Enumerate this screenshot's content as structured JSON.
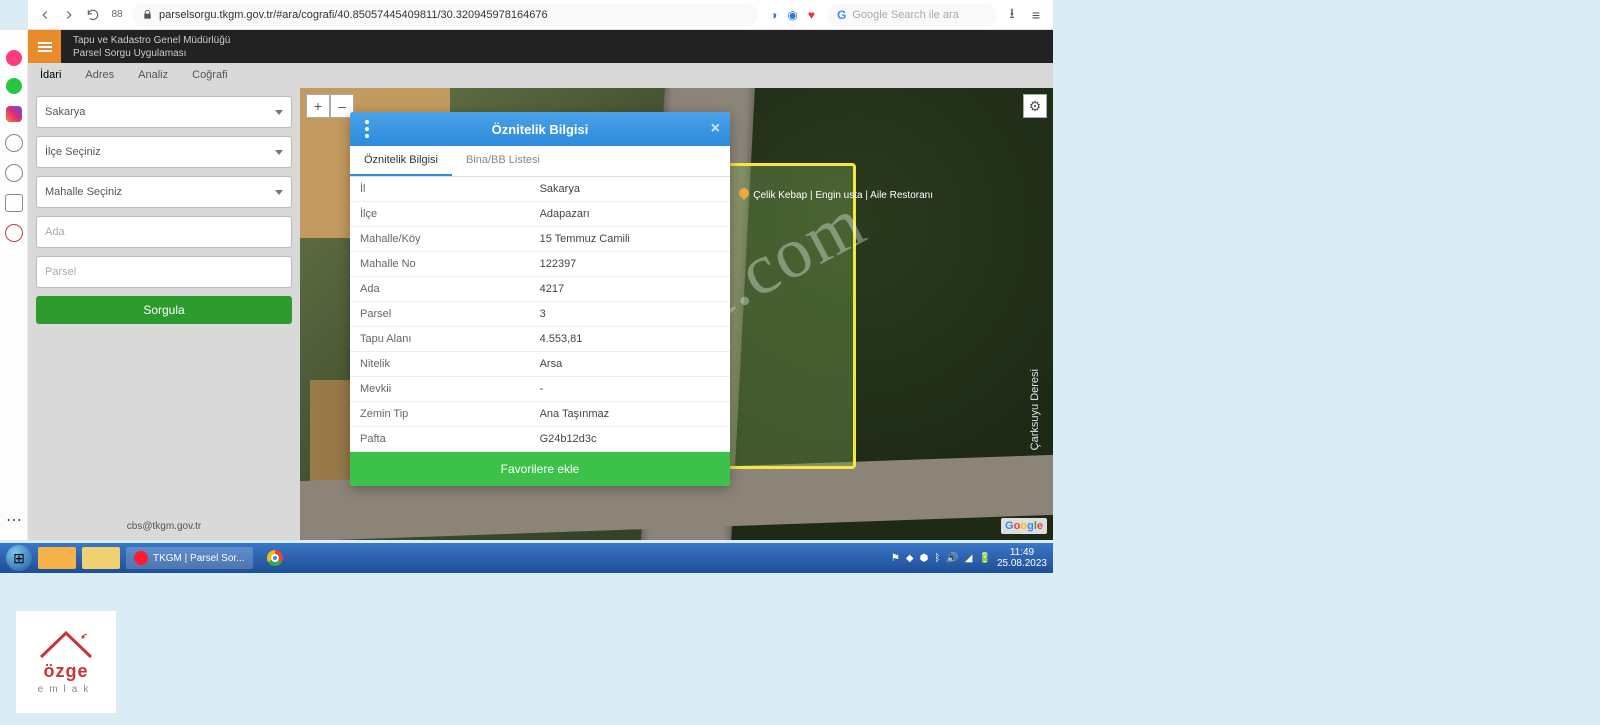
{
  "browser": {
    "url": "parselsorgu.tkgm.gov.tr/#ara/cografi/40.85057445409811/30.320945978164676",
    "search_placeholder": "Google Search ile ara"
  },
  "header": {
    "line1": "Tapu ve Kadastro Genel Müdürlüğü",
    "line2": "Parsel Sorgu Uygulaması"
  },
  "tabs": [
    "İdari",
    "Adres",
    "Analiz",
    "Coğrafi"
  ],
  "form": {
    "il": "Sakarya",
    "ilce_ph": "İlçe Seçiniz",
    "mahalle_ph": "Mahalle Seçiniz",
    "ada_ph": "Ada",
    "parsel_ph": "Parsel",
    "sorgula": "Sorgula",
    "email": "cbs@tkgm.gov.tr"
  },
  "map": {
    "plus": "+",
    "minus": "–",
    "gear": "⚙",
    "google": "Google",
    "poi": "Çelik Kebap | Engin usta | Aile Restoranı",
    "river": "Çarksuyu Deresi"
  },
  "watermark": "emlakjet.com",
  "popup": {
    "title": "Öznitelik Bilgisi",
    "tabs": [
      "Öznitelik Bilgisi",
      "Bina/BB Listesi"
    ],
    "rows": [
      {
        "k": "İl",
        "v": "Sakarya"
      },
      {
        "k": "İlçe",
        "v": "Adapazarı"
      },
      {
        "k": "Mahalle/Köy",
        "v": "15 Temmuz Camili"
      },
      {
        "k": "Mahalle No",
        "v": "122397"
      },
      {
        "k": "Ada",
        "v": "4217"
      },
      {
        "k": "Parsel",
        "v": "3"
      },
      {
        "k": "Tapu Alanı",
        "v": "4.553,81"
      },
      {
        "k": "Nitelik",
        "v": "Arsa"
      },
      {
        "k": "Mevkii",
        "v": "-"
      },
      {
        "k": "Zemin Tip",
        "v": "Ana Taşınmaz"
      },
      {
        "k": "Pafta",
        "v": "G24b12d3c"
      }
    ],
    "fav": "Favorilere ekle"
  },
  "taskbar": {
    "app1": "TKGM | Parsel Sor...",
    "time": "11:49",
    "date": "25.08.2023"
  },
  "logo": {
    "brand": "özge",
    "sub": "emlak"
  }
}
